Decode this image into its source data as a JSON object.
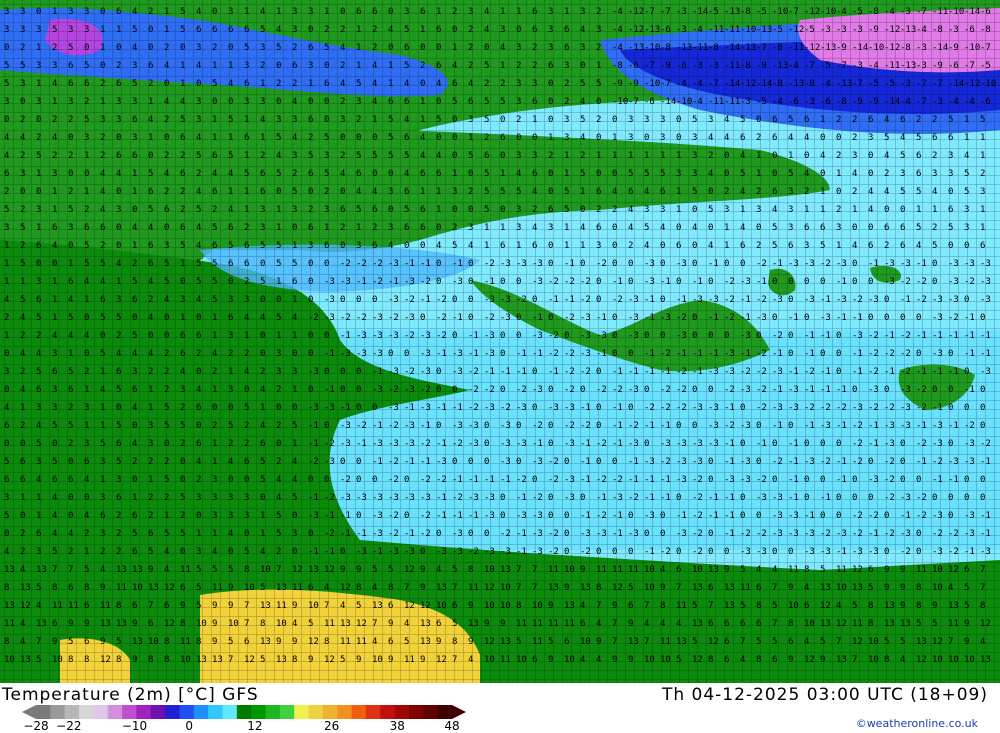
{
  "header": {
    "title": "Temperature (2m) [°C] GFS",
    "datetime": "Th 04-12-2025 03:00 UTC (18+09)",
    "credit": "©weatheronline.co.uk"
  },
  "legend": {
    "ticks": [
      "-28",
      "-22",
      "-10",
      "0",
      "12",
      "26",
      "38",
      "48"
    ],
    "scale_min": -28,
    "scale_max": 48,
    "colors": [
      "#7a7a7a",
      "#9a9a9a",
      "#b8b8b8",
      "#d6d6d6",
      "#e0c8e6",
      "#d090dc",
      "#c050d0",
      "#a020c0",
      "#7010b0",
      "#2020d0",
      "#2050f0",
      "#2090ff",
      "#30c8ff",
      "#60e8ff",
      "#007a00",
      "#009800",
      "#20b820",
      "#40d040",
      "#f0f050",
      "#f0d040",
      "#f0b030",
      "#f09020",
      "#f06010",
      "#e03010",
      "#c01010",
      "#a00808",
      "#800000",
      "#600000",
      "#400000"
    ]
  },
  "map_colors": {
    "sea_cold": "#7fe9ff",
    "sea_mid": "#4fd6ff",
    "land": "#1f9a1f",
    "land_dark": "#0c7a0c",
    "warm": "#f2d23a",
    "frost": "#2f6ef4",
    "deep_frost": "#1428d8",
    "purple": "#b545e0",
    "pink": "#e07ae6"
  }
}
